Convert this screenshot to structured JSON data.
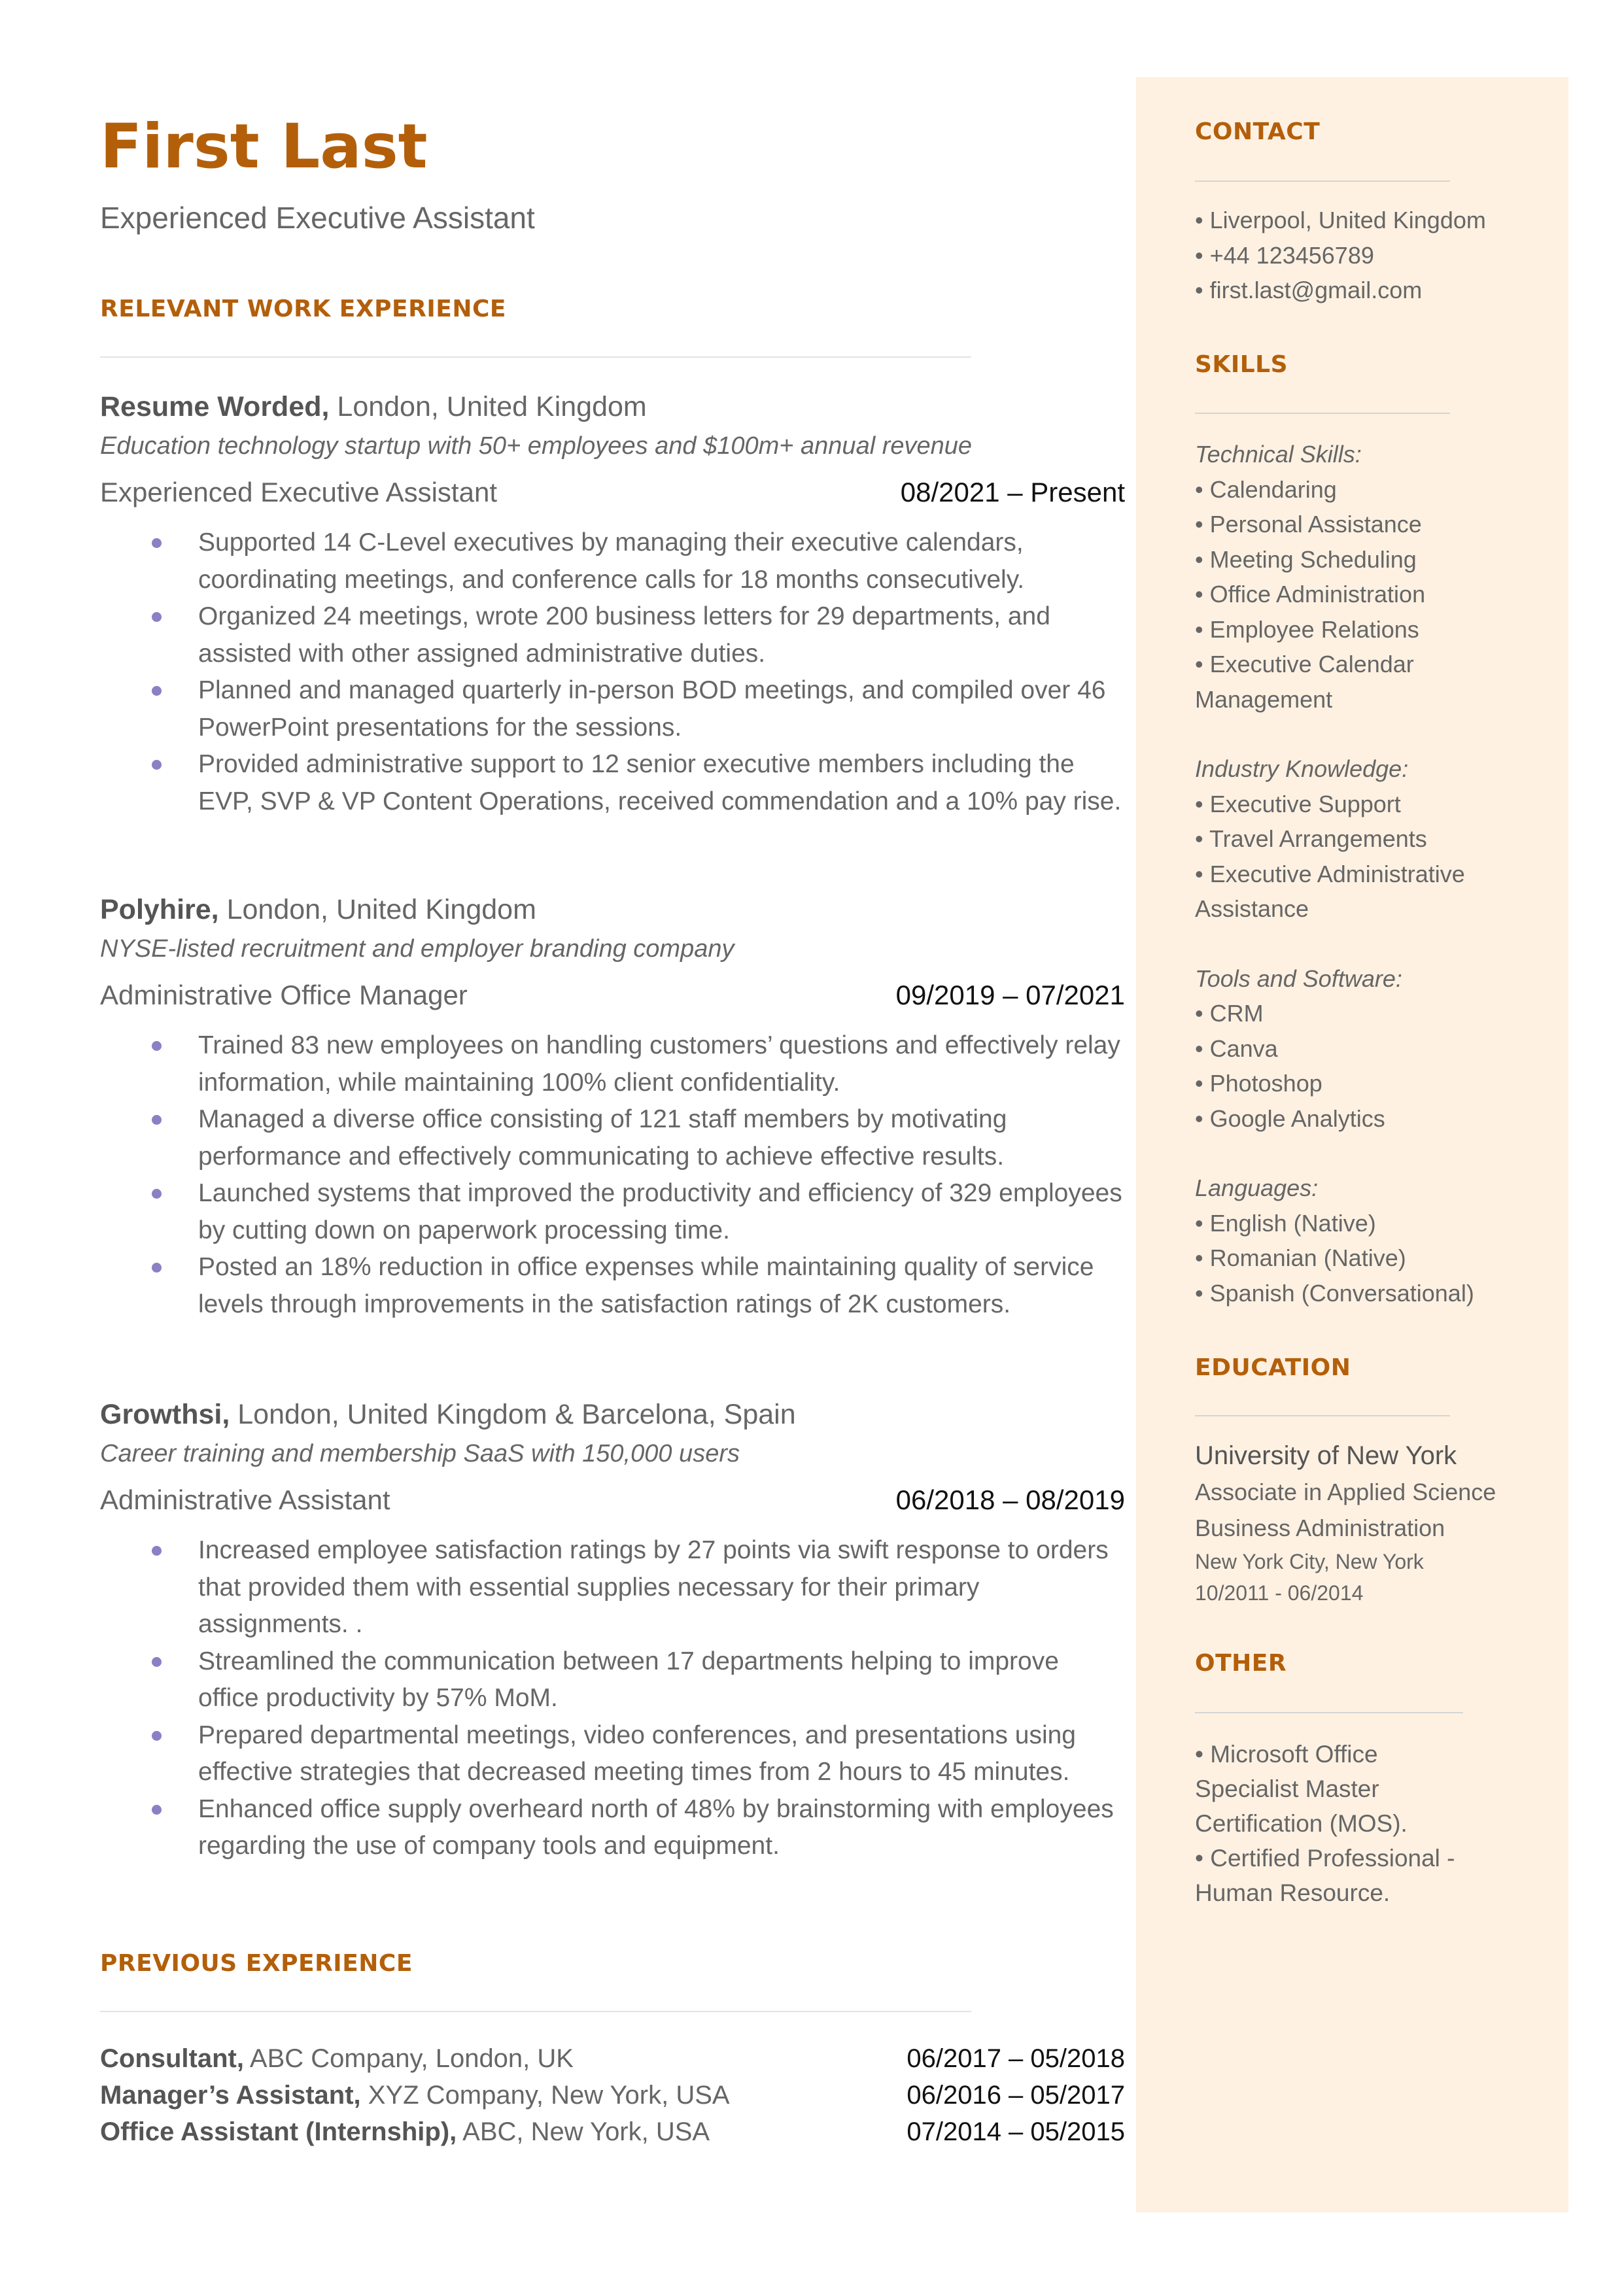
{
  "header": {
    "name": "First Last",
    "title": "Experienced Executive Assistant"
  },
  "colors": {
    "accent": "#b35f0a",
    "sidebar_bg": "#fef1e2",
    "bullet": "#8a80c4",
    "text": "#666666",
    "dates": "#111111"
  },
  "relevant_experience": {
    "heading": "RELEVANT WORK EXPERIENCE",
    "jobs": [
      {
        "company": "Resume Worded,",
        "location": " London, United Kingdom",
        "description": "Education technology startup with 50+ employees and $100m+ annual revenue",
        "role": "Experienced Executive Assistant",
        "dates": "08/2021 – Present",
        "bullets": [
          "Supported 14 C-Level executives by managing their executive calendars, coordinating meetings, and conference calls for 18 months consecutively.",
          "Organized 24 meetings, wrote 200 business letters for 29 departments, and assisted with other assigned administrative duties.",
          "Planned and managed quarterly in-person BOD meetings, and  compiled over 46 PowerPoint presentations for the sessions.",
          "Provided administrative support to 12 senior executive members including the EVP, SVP & VP Content Operations, received commendation and a 10% pay rise."
        ]
      },
      {
        "company": "Polyhire,",
        "location": " London, United Kingdom",
        "description": "NYSE-listed recruitment and employer branding company",
        "role": "Administrative Office Manager",
        "dates": "09/2019 – 07/2021",
        "bullets": [
          "Trained 83 new employees on handling customers’ questions and effectively relay information, while maintaining 100% client confidentiality.",
          "Managed a diverse office consisting of 121 staff members by motivating performance and effectively communicating to achieve effective results.",
          "Launched systems that improved the productivity and efficiency  of 329 employees by cutting down on paperwork processing time.",
          "Posted an 18% reduction in office expenses while maintaining quality of service levels through improvements in the satisfaction ratings of 2K customers."
        ]
      },
      {
        "company": "Growthsi,",
        "location": " London, United Kingdom & Barcelona, Spain",
        "description": "Career training and membership SaaS with 150,000 users",
        "role": "Administrative Assistant",
        "dates": "06/2018 – 08/2019",
        "bullets": [
          "Increased employee satisfaction ratings by 27 points via swift response to orders that provided them with essential supplies necessary for their primary assignments. .",
          "Streamlined the communication between 17 departments helping to improve office productivity by 57% MoM.",
          "Prepared departmental meetings, video conferences, and presentations using effective strategies that decreased meeting times from 2 hours to 45 minutes.",
          "Enhanced office supply overheard north of 48% by brainstorming with employees regarding the use of company tools and equipment."
        ]
      }
    ]
  },
  "previous_experience": {
    "heading": "PREVIOUS EXPERIENCE",
    "items": [
      {
        "role": "Consultant,",
        "detail": " ABC Company, London, UK",
        "dates": "06/2017 – 05/2018"
      },
      {
        "role": "Manager’s Assistant,",
        "detail": " XYZ Company, New York, USA",
        "dates": "06/2016 – 05/2017"
      },
      {
        "role": "Office Assistant (Internship),",
        "detail": " ABC, New York, USA",
        "dates": "07/2014 – 05/2015"
      }
    ]
  },
  "sidebar": {
    "contact": {
      "heading": "CONTACT",
      "items": [
        "• Liverpool, United Kingdom",
        "• +44 123456789",
        "• first.last@gmail.com"
      ]
    },
    "skills": {
      "heading": "SKILLS",
      "groups": [
        {
          "label": "Technical Skills:",
          "items": [
            "•  Calendaring",
            "•  Personal Assistance",
            "•  Meeting Scheduling",
            "•  Office Administration",
            "•  Employee Relations",
            "•  Executive Calendar Management"
          ]
        },
        {
          "label": "Industry Knowledge:",
          "items": [
            "•  Executive Support",
            "• Travel Arrangements",
            "•  Executive Administrative Assistance"
          ]
        },
        {
          "label": "Tools and Software:",
          "items": [
            "•  CRM",
            "•  Canva",
            "•  Photoshop",
            "•  Google Analytics"
          ]
        },
        {
          "label": "Languages:",
          "items": [
            "•  English (Native)",
            "•  Romanian (Native)",
            "•  Spanish (Conversational)"
          ]
        }
      ]
    },
    "education": {
      "heading": "EDUCATION",
      "school": "University of New York",
      "degree_line1": "Associate in Applied Science",
      "degree_line2": "Business Administration",
      "location": "New York City, New York",
      "dates": "10/2011 - 06/2014"
    },
    "other": {
      "heading": "OTHER",
      "items": [
        "•  Microsoft Office Specialist Master Certification (MOS).",
        "•  Certified Professional - Human Resource."
      ]
    }
  }
}
